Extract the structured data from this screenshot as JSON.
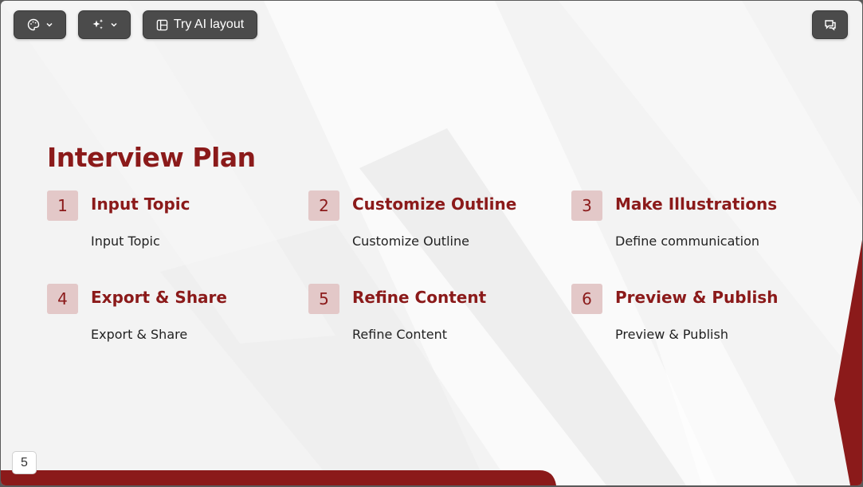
{
  "toolbar": {
    "theme_icon": "palette-icon",
    "magic_icon": "sparkles-icon",
    "ai_layout_label": "Try AI layout",
    "ai_layout_icon": "layout-icon",
    "comment_icon": "comment-icon",
    "chevron_icon": "chevron-down-icon"
  },
  "slide": {
    "title": "Interview Plan",
    "steps": [
      {
        "number": "1",
        "title": "Input Topic",
        "description": "Input Topic"
      },
      {
        "number": "2",
        "title": "Customize Outline",
        "description": "Customize Outline"
      },
      {
        "number": "3",
        "title": "Make Illustrations",
        "description": "Define communication"
      },
      {
        "number": "4",
        "title": "Export & Share",
        "description": "Export & Share"
      },
      {
        "number": "5",
        "title": "Refine Content",
        "description": "Refine Content"
      },
      {
        "number": "6",
        "title": "Preview & Publish",
        "description": "Preview & Publish"
      }
    ]
  },
  "page_number": "5",
  "colors": {
    "accent": "#8b1a1a",
    "number_bg": "#e3c8c8",
    "slide_bg": "#f3f3f3",
    "toolbar_bg": "#4b4b4b",
    "text": "#222222"
  }
}
